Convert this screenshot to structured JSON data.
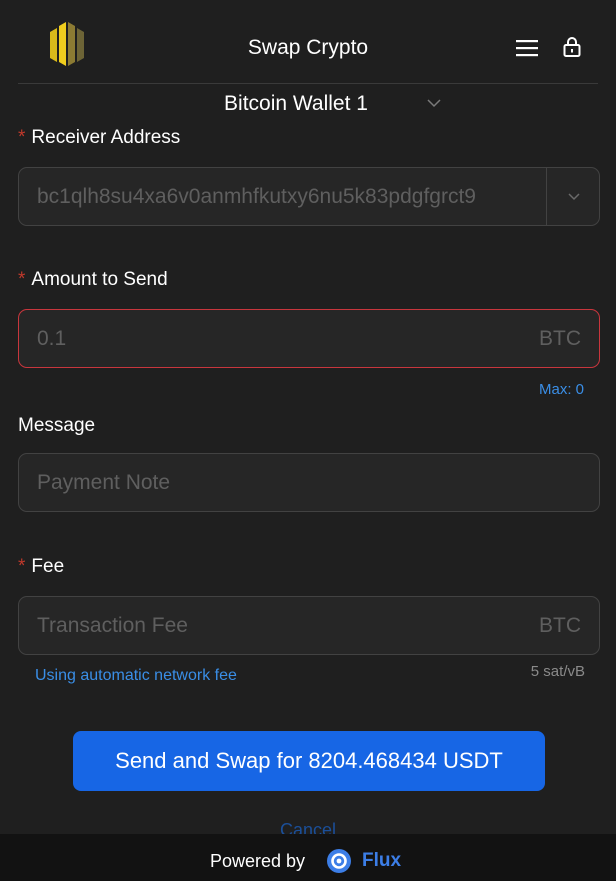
{
  "header": {
    "title": "Swap Crypto",
    "logo_icon": "brand-logo-icon",
    "menu_icon": "hamburger-menu-icon",
    "lock_icon": "lock-icon"
  },
  "wallet": {
    "selected": "Bitcoin Wallet 1"
  },
  "form": {
    "receiver": {
      "label": "Receiver Address",
      "value": "bc1qlh8su4xa6v0anmhfkutxy6nu5k83pdgfgrct9"
    },
    "amount": {
      "label": "Amount to Send",
      "placeholder": "0.1",
      "unit": "BTC",
      "max_label": "Max: 0"
    },
    "message": {
      "label": "Message",
      "placeholder": "Payment Note"
    },
    "fee": {
      "label": "Fee",
      "placeholder": "Transaction Fee",
      "unit": "BTC",
      "note": "Using automatic network fee",
      "rate": "5 sat/vB"
    },
    "required_mark": "*"
  },
  "actions": {
    "send_label": "Send and Swap for 8204.468434 USDT",
    "cancel_label": "Cancel"
  },
  "footer": {
    "powered_by": "Powered by",
    "brand": "Flux"
  },
  "colors": {
    "background": "#1f1f1f",
    "accent": "#1766e5",
    "link": "#3a8ee6",
    "error_border": "#c8363d",
    "required": "#c0392b"
  }
}
